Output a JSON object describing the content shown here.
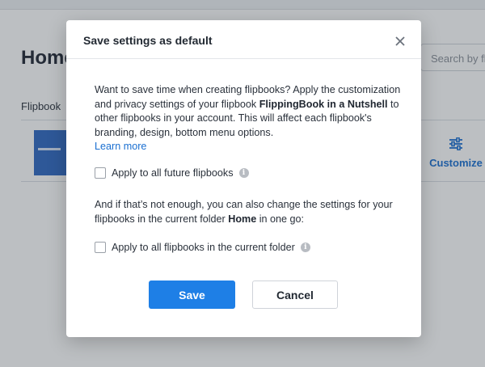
{
  "background": {
    "page_title": "Home",
    "search_placeholder": "Search by flipbook",
    "column_header": "Flipbook",
    "customize_label": "Customize"
  },
  "modal": {
    "title": "Save settings as default",
    "close_icon": "close-icon",
    "intro_lead": "Want to save time when creating flipbooks? Apply the customization and privacy settings of your flipbook ",
    "flipbook_name": "FlippingBook in a Nutshell",
    "intro_tail": " to other flipbooks in your account. This will affect each flipbook's branding, design, bottom menu options.",
    "learn_more": "Learn more",
    "option_future": "Apply to all future flipbooks",
    "folder_lead": "And if that’s not enough, you can also change the settings for your flipbooks in the current folder ",
    "folder_name": "Home",
    "folder_tail": " in one go:",
    "option_folder": "Apply to all flipbooks in the current folder",
    "save_label": "Save",
    "cancel_label": "Cancel",
    "info_icon": "info-icon"
  },
  "colors": {
    "accent": "#1e7fe6",
    "link": "#1a6fd1",
    "overlay": "rgba(48,55,66,0.32)"
  }
}
